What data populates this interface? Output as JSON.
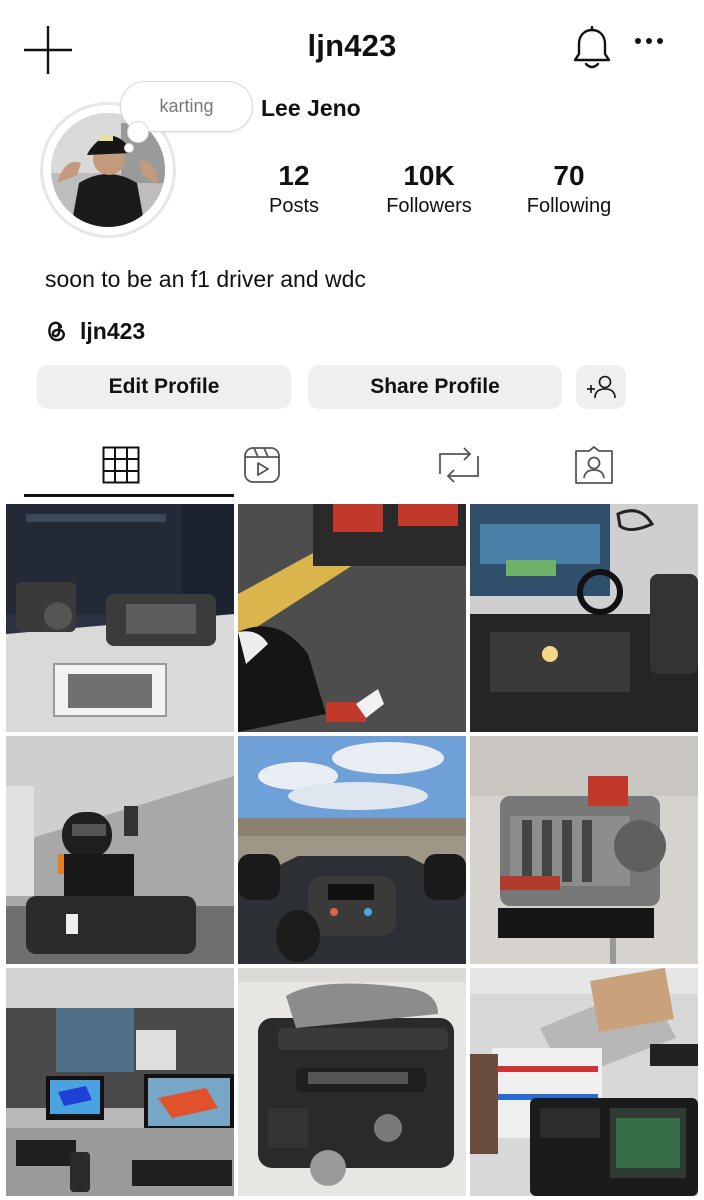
{
  "header": {
    "username": "ljn423",
    "icons": {
      "create": "plus-icon",
      "notifications": "bell-icon",
      "more": "more-horizontal-icon"
    }
  },
  "profile": {
    "note": "karting",
    "display_name": "Lee Jeno",
    "stats": [
      {
        "value": "12",
        "label": "Posts"
      },
      {
        "value": "10K",
        "label": "Followers"
      },
      {
        "value": "70",
        "label": "Following"
      }
    ],
    "bio": "soon to be an f1 driver and wdc",
    "threads_handle": "ljn423"
  },
  "actions": {
    "edit_profile": "Edit Profile",
    "share_profile": "Share Profile",
    "discover_icon": "add-person-icon"
  },
  "tabs": [
    {
      "icon": "grid-icon",
      "active": true
    },
    {
      "icon": "reels-icon",
      "active": false
    },
    {
      "icon": "reposts-icon",
      "active": false
    },
    {
      "icon": "tagged-icon",
      "active": false
    }
  ],
  "posts": [
    {
      "subject": "engine-exhibit"
    },
    {
      "subject": "karting-track-selfie"
    },
    {
      "subject": "sim-racing-rig"
    },
    {
      "subject": "karting-driver"
    },
    {
      "subject": "formula-car-cockpit"
    },
    {
      "subject": "gearbox-display"
    },
    {
      "subject": "cad-lab"
    },
    {
      "subject": "race-engine"
    },
    {
      "subject": "electronics-lab"
    }
  ]
}
